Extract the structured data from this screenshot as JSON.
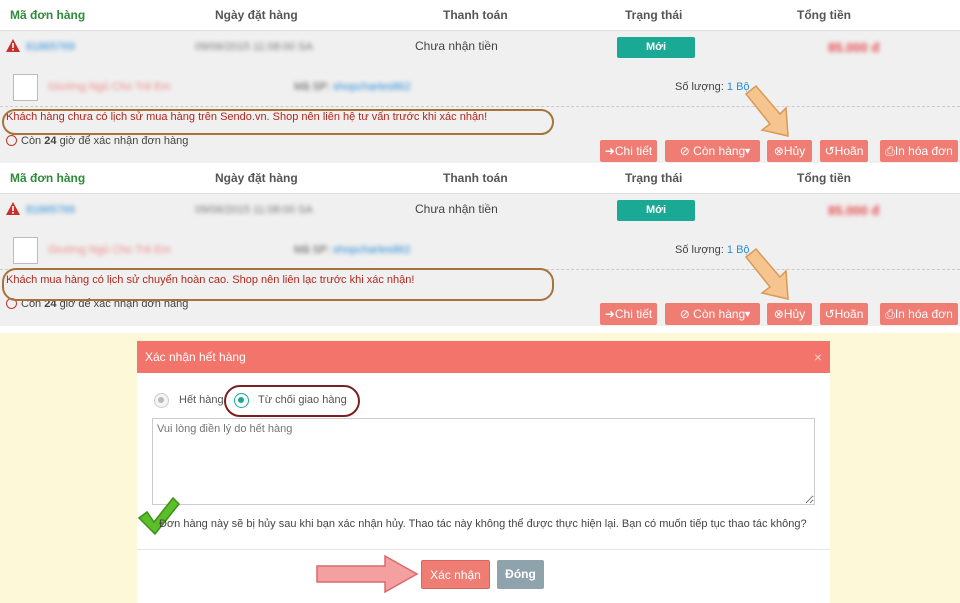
{
  "headers": {
    "order_id": "Mã đơn hàng",
    "order_date": "Ngày đặt hàng",
    "payment": "Thanh toán",
    "status": "Trạng thái",
    "total": "Tổng tiền"
  },
  "orders": [
    {
      "order_id": "81865769",
      "date": "09/06/2015 11:08:00 SA",
      "payment": "Chưa nhận tiền",
      "status": "Mới",
      "total": "85.000 đ",
      "product_name": "Giường Ngủ Cho Trẻ Em",
      "sku_label": "Mã SP:",
      "sku_value": "shopcharles862",
      "qty_label": "Số lượng:",
      "qty_value": "1 Bộ",
      "note": "Khách hàng chưa có lịch sử mua hàng trên Sendo.vn. Shop nên liên hệ tư vấn trước khi xác nhận!",
      "timer_pre": "Còn",
      "timer_hours": "24",
      "timer_post": "giờ để xác nhận đơn hàng"
    },
    {
      "order_id": "81865769",
      "date": "09/06/2015 11:08:00 SA",
      "payment": "Chưa nhận tiền",
      "status": "Mới",
      "total": "85.000 đ",
      "product_name": "Giường Ngủ Cho Trẻ Em",
      "sku_label": "Mã SP:",
      "sku_value": "shopcharles862",
      "qty_label": "Số lượng:",
      "qty_value": "1 Bộ",
      "note": "Khách mua hàng có lịch sử chuyển hoàn cao. Shop nên liên lạc trước khi xác nhận!",
      "timer_pre": "Còn",
      "timer_hours": "24",
      "timer_post": "giờ để xác nhận đơn hàng"
    }
  ],
  "actions": {
    "detail": "➜Chi tiết",
    "in_stock": "⊘ Còn hàng",
    "cancel": "⊗Hủy",
    "return": "↺Hoãn",
    "print": "⎙In hóa đơn"
  },
  "modal": {
    "title": "Xác nhận hết hàng",
    "close": "×",
    "option_out_of_stock": "Hết hàng",
    "option_refuse": "Từ chối giao hàng",
    "reason_placeholder": "Vui lòng điền lý do hết hàng",
    "message": "Đơn hàng này sẽ bị hủy sau khi bạn xác nhận hủy. Thao tác này không thể được thực hiện lại. Bạn có muốn tiếp tục thao tác không?",
    "confirm": "Xác nhận",
    "dismiss": "Đóng"
  },
  "colors": {
    "accent": "#f2746b",
    "status": "#1aa994",
    "header_green": "#2e8b3a"
  }
}
